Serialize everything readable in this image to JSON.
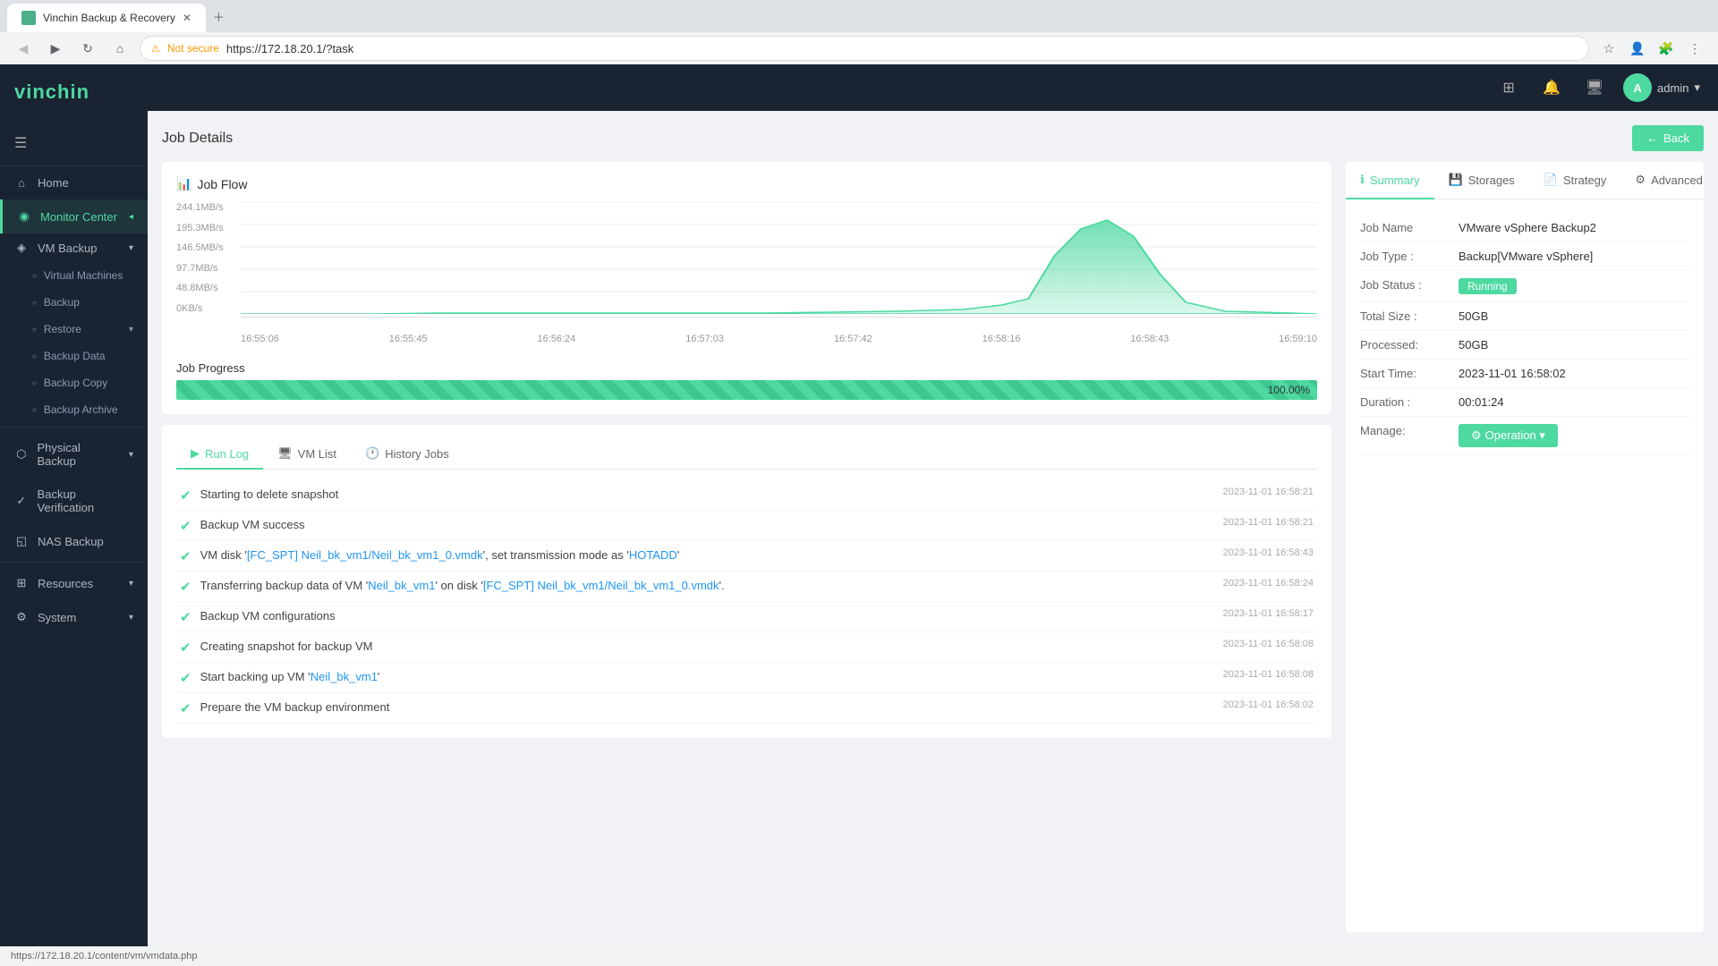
{
  "browser": {
    "tab_title": "Vinchin Backup & Recovery",
    "url": "https://172.18.20.1/?task",
    "secure_label": "Not secure",
    "status_bar_url": "https://172.18.20.1/content/vm/vmdata.php"
  },
  "header": {
    "logo": "vinchin",
    "user": "admin",
    "menu_icon": "☰"
  },
  "sidebar": {
    "items": [
      {
        "id": "home",
        "label": "Home",
        "icon": "⌂"
      },
      {
        "id": "monitor",
        "label": "Monitor Center",
        "icon": "◉",
        "active": true,
        "expanded": true
      },
      {
        "id": "vm-backup",
        "label": "VM Backup",
        "icon": "◈",
        "expanded": true
      },
      {
        "id": "virtual-machines",
        "label": "Virtual Machines",
        "sub": true
      },
      {
        "id": "backup",
        "label": "Backup",
        "sub": true
      },
      {
        "id": "restore",
        "label": "Restore",
        "sub": true
      },
      {
        "id": "backup-data",
        "label": "Backup Data",
        "sub": true
      },
      {
        "id": "backup-copy",
        "label": "Backup Copy",
        "sub": true
      },
      {
        "id": "backup-archive",
        "label": "Backup Archive",
        "sub": true
      },
      {
        "id": "physical-backup",
        "label": "Physical Backup",
        "icon": "⬡"
      },
      {
        "id": "backup-verification",
        "label": "Backup Verification",
        "icon": "✓"
      },
      {
        "id": "nas-backup",
        "label": "NAS Backup",
        "icon": "◱"
      },
      {
        "id": "resources",
        "label": "Resources",
        "icon": "⊞"
      },
      {
        "id": "system",
        "label": "System",
        "icon": "⚙"
      }
    ]
  },
  "page": {
    "title": "Job Details",
    "back_label": "← Back"
  },
  "job_flow": {
    "title": "Job Flow",
    "y_labels": [
      "244.1MB/s",
      "195.3MB/s",
      "146.5MB/s",
      "97.7MB/s",
      "48.8MB/s",
      "0KB/s"
    ],
    "x_labels": [
      "16:55:06",
      "16:55:45",
      "16:56:24",
      "16:57:03",
      "16:57:42",
      "16:58:16",
      "16:58:43",
      "16:59:10"
    ],
    "progress_label": "Job Progress",
    "progress_pct": "100.00%",
    "progress_value": 100
  },
  "tabs": [
    {
      "id": "run-log",
      "label": "Run Log",
      "icon": "📋",
      "active": true
    },
    {
      "id": "vm-list",
      "label": "VM List",
      "icon": "🖥"
    },
    {
      "id": "history-jobs",
      "label": "History Jobs",
      "icon": "🕐"
    }
  ],
  "log_entries": [
    {
      "text": "Starting to delete snapshot",
      "time": "2023-11-01 16:58:21",
      "status": "success"
    },
    {
      "text": "Backup VM success",
      "time": "2023-11-01 16:58:21",
      "status": "success"
    },
    {
      "text_parts": [
        {
          "type": "plain",
          "text": "VM disk '"
        },
        {
          "type": "highlight",
          "text": "[FC_SPT] Neil_bk_vm1/Neil_bk_vm1_0.vmdk"
        },
        {
          "type": "plain",
          "text": "', set transmission mode as '"
        },
        {
          "type": "highlight",
          "text": "HOTADD"
        },
        {
          "type": "plain",
          "text": "'"
        }
      ],
      "time": "2023-11-01 16:58:43",
      "status": "success",
      "combined": "VM disk '[FC_SPT] Neil_bk_vm1/Neil_bk_vm1_0.vmdk', set transmission mode as 'HOTADD'"
    },
    {
      "text_parts": [
        {
          "type": "plain",
          "text": "Transferring backup data of VM '"
        },
        {
          "type": "highlight",
          "text": "Neil_bk_vm1"
        },
        {
          "type": "plain",
          "text": "' on disk '"
        },
        {
          "type": "highlight",
          "text": "[FC_SPT] Neil_bk_vm1/Neil_bk_vm1_0.vmdk"
        },
        {
          "type": "plain",
          "text": "'."
        }
      ],
      "time": "2023-11-01 16:58:24",
      "status": "success",
      "combined": "Transferring backup data of VM 'Neil_bk_vm1' on disk '[FC_SPT] Neil_bk_vm1/Neil_bk_vm1_0.vmdk'."
    },
    {
      "text": "Backup VM configurations",
      "time": "2023-11-01 16:58:17",
      "status": "success"
    },
    {
      "text": "Creating snapshot for backup VM",
      "time": "2023-11-01 16:58:08",
      "status": "success"
    },
    {
      "text_parts": [
        {
          "type": "plain",
          "text": "Start backing up VM '"
        },
        {
          "type": "highlight",
          "text": "Neil_bk_vm1"
        },
        {
          "type": "plain",
          "text": "'"
        }
      ],
      "time": "2023-11-01 16:58:08",
      "status": "success",
      "combined": "Start backing up VM 'Neil_bk_vm1'"
    },
    {
      "text": "Prepare the VM backup environment",
      "time": "2023-11-01 16:58:02",
      "status": "success"
    }
  ],
  "summary": {
    "tabs": [
      {
        "id": "summary",
        "label": "Summary",
        "icon": "ℹ",
        "active": true
      },
      {
        "id": "storages",
        "label": "Storages",
        "icon": "💾"
      },
      {
        "id": "strategy",
        "label": "Strategy",
        "icon": "📄"
      },
      {
        "id": "advanced",
        "label": "Advanced",
        "icon": "⚙"
      }
    ],
    "fields": [
      {
        "key": "Job Name",
        "value": "VMware vSphere Backup2",
        "id": "job-name"
      },
      {
        "key": "Job Type :",
        "value": "Backup[VMware vSphere]",
        "id": "job-type"
      },
      {
        "key": "Job Status :",
        "value": "Running",
        "id": "job-status",
        "badge": true
      },
      {
        "key": "Total Size :",
        "value": "50GB",
        "id": "total-size"
      },
      {
        "key": "Processed:",
        "value": "50GB",
        "id": "processed"
      },
      {
        "key": "Start Time:",
        "value": "2023-11-01 16:58:02",
        "id": "start-time"
      },
      {
        "key": "Duration :",
        "value": "00:01:24",
        "id": "duration"
      },
      {
        "key": "Manage:",
        "value": "Operation",
        "id": "manage"
      }
    ],
    "operation_label": "Operation ▾"
  }
}
